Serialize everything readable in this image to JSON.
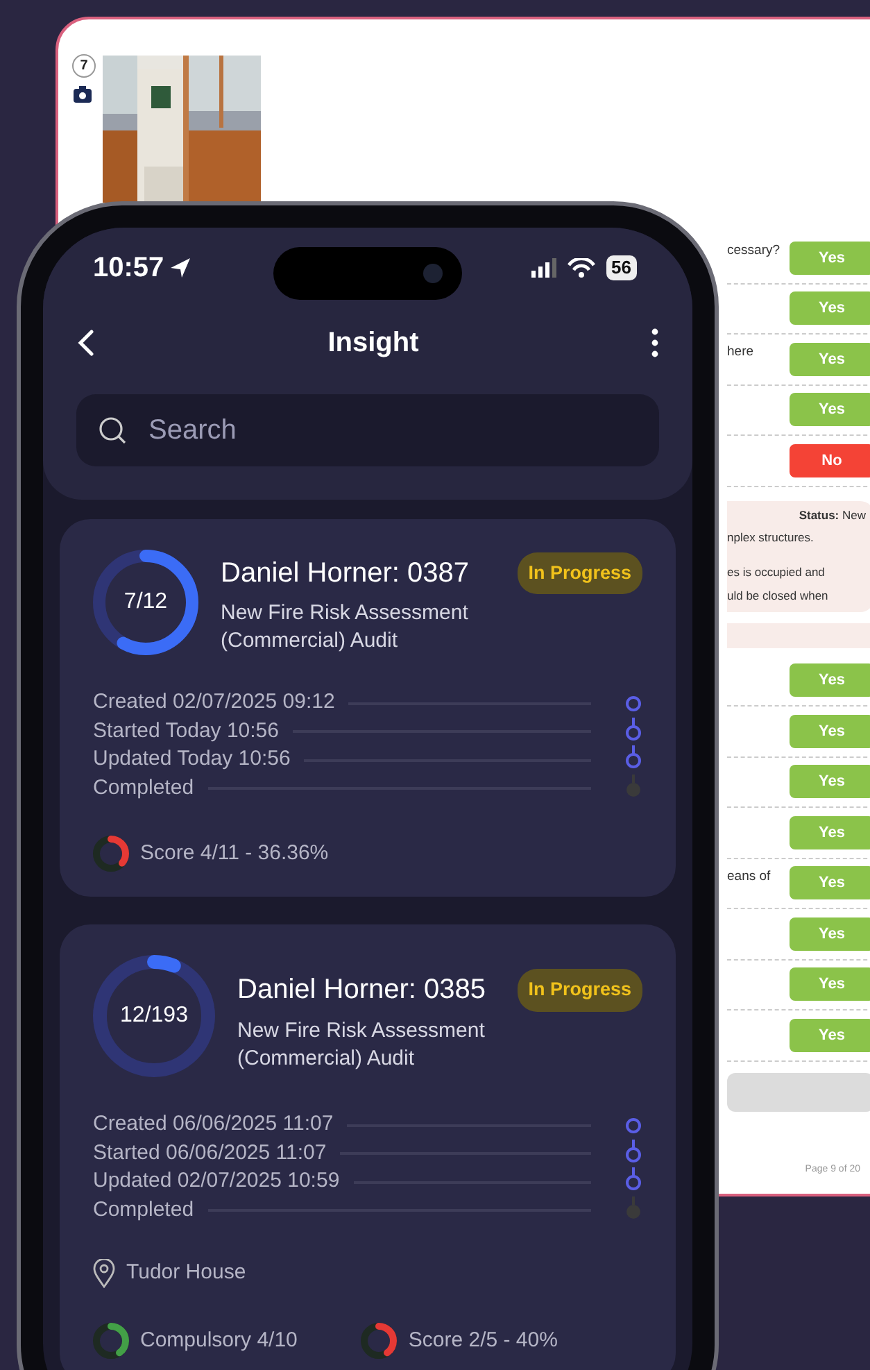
{
  "document": {
    "question_number": "7",
    "rows": [
      {
        "kind": "answer",
        "text": "cessary?",
        "answer": "Yes",
        "positive": true
      },
      {
        "kind": "answer",
        "answer": "Yes",
        "positive": true
      },
      {
        "kind": "answer",
        "text": "here",
        "answer": "Yes",
        "positive": true
      },
      {
        "kind": "answer",
        "answer": "Yes",
        "positive": true
      },
      {
        "kind": "answer",
        "answer": "No",
        "positive": false
      },
      {
        "kind": "status",
        "status": "**Status:** New",
        "lines": [
          "nplex structures.",
          "es is occupied and",
          "uld be closed when"
        ]
      },
      {
        "kind": "band"
      },
      {
        "kind": "answer",
        "answer": "Yes",
        "positive": true
      },
      {
        "kind": "answer",
        "answer": "Yes",
        "positive": true
      },
      {
        "kind": "answer",
        "answer": "Yes",
        "positive": true
      },
      {
        "kind": "answer",
        "answer": "Yes",
        "positive": true
      },
      {
        "kind": "answer",
        "text": "eans of",
        "answer": "Yes",
        "positive": true
      },
      {
        "kind": "answer",
        "answer": "Yes",
        "positive": true
      },
      {
        "kind": "answer",
        "answer": "Yes",
        "positive": true
      },
      {
        "kind": "answer",
        "answer": "Yes",
        "positive": true
      },
      {
        "kind": "blank_field"
      }
    ],
    "page": "Page 9 of 20"
  },
  "phone": {
    "status_bar": {
      "time": "10:57",
      "battery": "56"
    },
    "title": "Insight",
    "search": {
      "placeholder": "Search"
    },
    "audits": [
      {
        "name": "Daniel Horner: 0387",
        "status": "In Progress",
        "progress": "7/12",
        "level": 0.58,
        "description": "New Fire Risk Assessment (Commercial) Audit",
        "timeline": [
          {
            "text": "Created 02/07/2025 09:12",
            "done": true
          },
          {
            "text": "Started Today 10:56",
            "done": true
          },
          {
            "text": "Updated Today 10:56",
            "done": true
          },
          {
            "text": "Completed",
            "done": false
          }
        ],
        "metrics": [
          {
            "text": "Score 4/11 - 36.36%",
            "level": 0.36,
            "color": "#e53935"
          }
        ]
      },
      {
        "name": "Daniel Horner: 0385",
        "status": "In Progress",
        "progress": "12/193",
        "level": 0.06,
        "description": "New Fire Risk Assessment (Commercial) Audit",
        "timeline": [
          {
            "text": "Created 06/06/2025 11:07",
            "done": true
          },
          {
            "text": "Started 06/06/2025 11:07",
            "done": true
          },
          {
            "text": "Updated 02/07/2025 10:59",
            "done": true
          },
          {
            "text": "Completed",
            "done": false
          }
        ],
        "location": "Tudor House",
        "metrics": [
          {
            "text": "Compulsory 4/10",
            "level": 0.4,
            "color": "#43a047"
          },
          {
            "text": "Score 2/5 - 40%",
            "level": 0.4,
            "color": "#e53935"
          }
        ]
      }
    ]
  }
}
